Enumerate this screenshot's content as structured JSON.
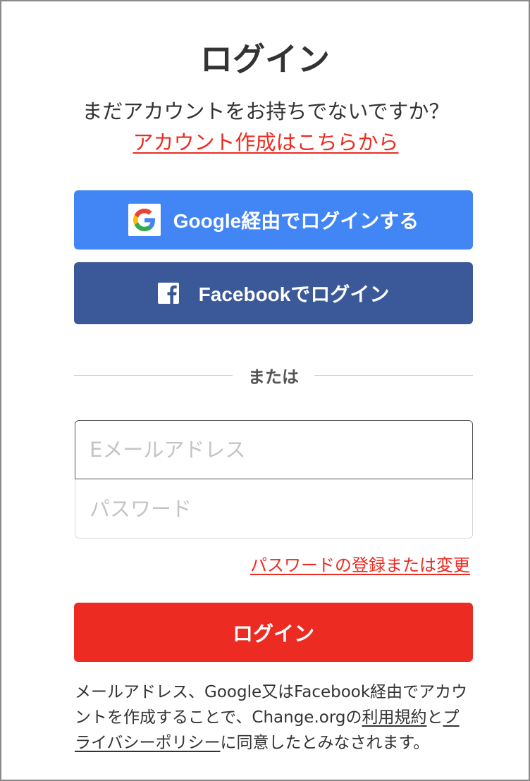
{
  "header": {
    "title": "ログイン",
    "subtitle_prefix": "まだアカウントをお持ちでないですか？",
    "signup_link": "アカウント作成はこちらから"
  },
  "social": {
    "google_label": "Google経由でログインする",
    "facebook_label": "Facebookでログイン"
  },
  "divider": {
    "label": "または"
  },
  "form": {
    "email_placeholder": "Eメールアドレス",
    "email_value": "",
    "password_placeholder": "パスワード",
    "password_value": "",
    "forgot_link": "パスワードの登録または変更",
    "submit_label": "ログイン"
  },
  "legal": {
    "text_1": "メールアドレス、Google又はFacebook経由でアカウントを作成することで、Change.orgの",
    "terms_link": "利用規約",
    "text_2": "と",
    "privacy_link": "プライバシーポリシー",
    "text_3": "に同意したとみなされます。"
  },
  "colors": {
    "accent_red": "#ec2c22",
    "google_blue": "#4285f4",
    "facebook_blue": "#3b5998"
  }
}
